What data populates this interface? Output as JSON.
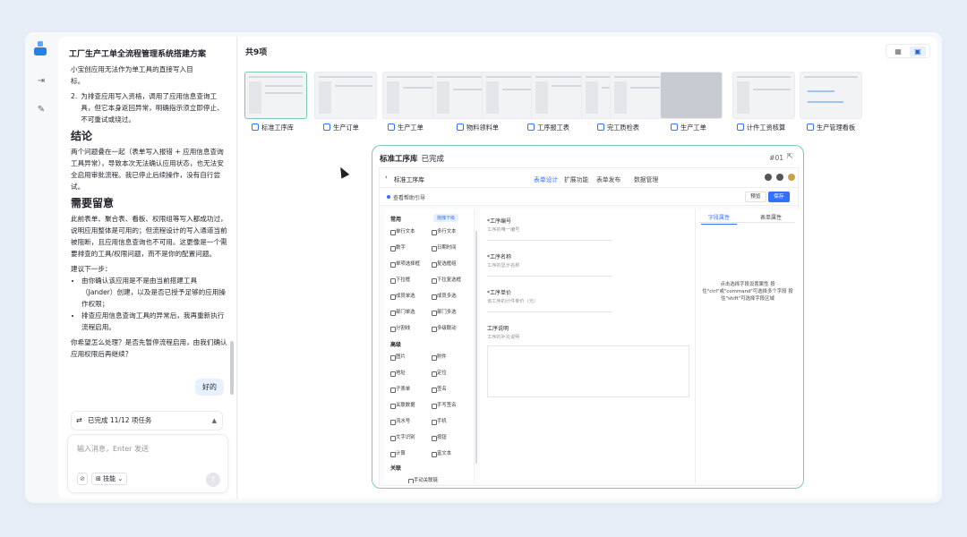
{
  "chat": {
    "title": "工厂生产工单全流程管理系统搭建方案",
    "intro_lines": [
      "小宝创应用无法作为单工具的直接写入目",
      "标。"
    ],
    "list1": [
      "为排查应用写入资格，调用了应用信息查询工具，但它本身返回异常，明确指示须立即停止、不可重试或绕过。"
    ],
    "list1_start": "2.",
    "h_conclusion": "结论",
    "conclusion": "两个问题叠在一起（表单写入报错 + 应用信息查询工具异常），导致本次无法确认应用状态，也无法安全启用审批流程。我已停止后续操作，没有自行尝试。",
    "h_attention": "需要留意",
    "attention": "此前表单、聚合表、看板、权限组等写入都成功过，说明应用整体是可用的；但流程设计的写入通道当前被阻断，且应用信息查询也不可用。这更像是一个需要排查的工具/权限问题，而不是你的配置问题。",
    "next_label": "建议下一步：",
    "next_items": [
      "由你确认该应用是不是由当前搭建工具（Jander）创建，以及是否已授予足够的应用操作权限；",
      "排查应用信息查询工具的异常后，我再重新执行流程启用。"
    ],
    "question": "你希望怎么处理？是否先暂停流程启用，由我们确认应用权限后再继续？",
    "user_reply": "好的",
    "task_status": "已完成 11/12 项任务",
    "input_placeholder": "输入消息，Enter 发送",
    "mode_label": "技能"
  },
  "gallery": {
    "count_label": "共9项",
    "items": [
      {
        "label": "标准工序库"
      },
      {
        "label": "生产订单"
      },
      {
        "label": "生产工单"
      },
      {
        "label": "物料领料单"
      },
      {
        "label": "工序报工表"
      },
      {
        "label": "完工质检表"
      },
      {
        "label": "生产工单"
      },
      {
        "label": "计件工资核算"
      },
      {
        "label": "生产管理看板"
      }
    ]
  },
  "preview": {
    "title": "标准工序库",
    "status": "已完成",
    "number": "#01",
    "app": {
      "back_label": "标准工序库",
      "tabs": [
        "表单设计",
        "扩展功能",
        "表单发布",
        "数据管理"
      ],
      "active_tab": 0,
      "crumb": "查看帮助引导",
      "preview_btn": "预览",
      "save_btn": "保存",
      "palette": {
        "group_common": "常用",
        "badge": "拖拽下级",
        "common_items": [
          "单行文本",
          "多行文本",
          "数字",
          "日期时间",
          "单项选择框",
          "复选框组",
          "下拉框",
          "下拉复选框",
          "成员单选",
          "成员多选",
          "部门单选",
          "部门多选",
          "分割线",
          "多级联动"
        ],
        "group_advanced": "高级",
        "advanced_items": [
          "图片",
          "附件",
          "地址",
          "定位",
          "子表单",
          "签名",
          "关联数据",
          "手写签名",
          "流水号",
          "手机",
          "文字识别",
          "按钮",
          "计算",
          "富文本"
        ],
        "group_relation": "关联",
        "relation_item": "手动关联链"
      },
      "fields": [
        {
          "label": "*工序编号",
          "hint": "工序的唯一编号"
        },
        {
          "label": "*工序名称",
          "hint": "工序的显示名称"
        },
        {
          "label": "*工序单价",
          "hint": "该工序的计件单价（元）"
        },
        {
          "label": "工序说明",
          "hint": "工序的补充说明"
        }
      ],
      "props_tabs": [
        "字段属性",
        "表单属性"
      ],
      "props_hint": "点击选择字段设置属性 按住\"ctrl\"或\"command\"可选择多个字段 按住\"shift\"可选择字段区域"
    }
  }
}
